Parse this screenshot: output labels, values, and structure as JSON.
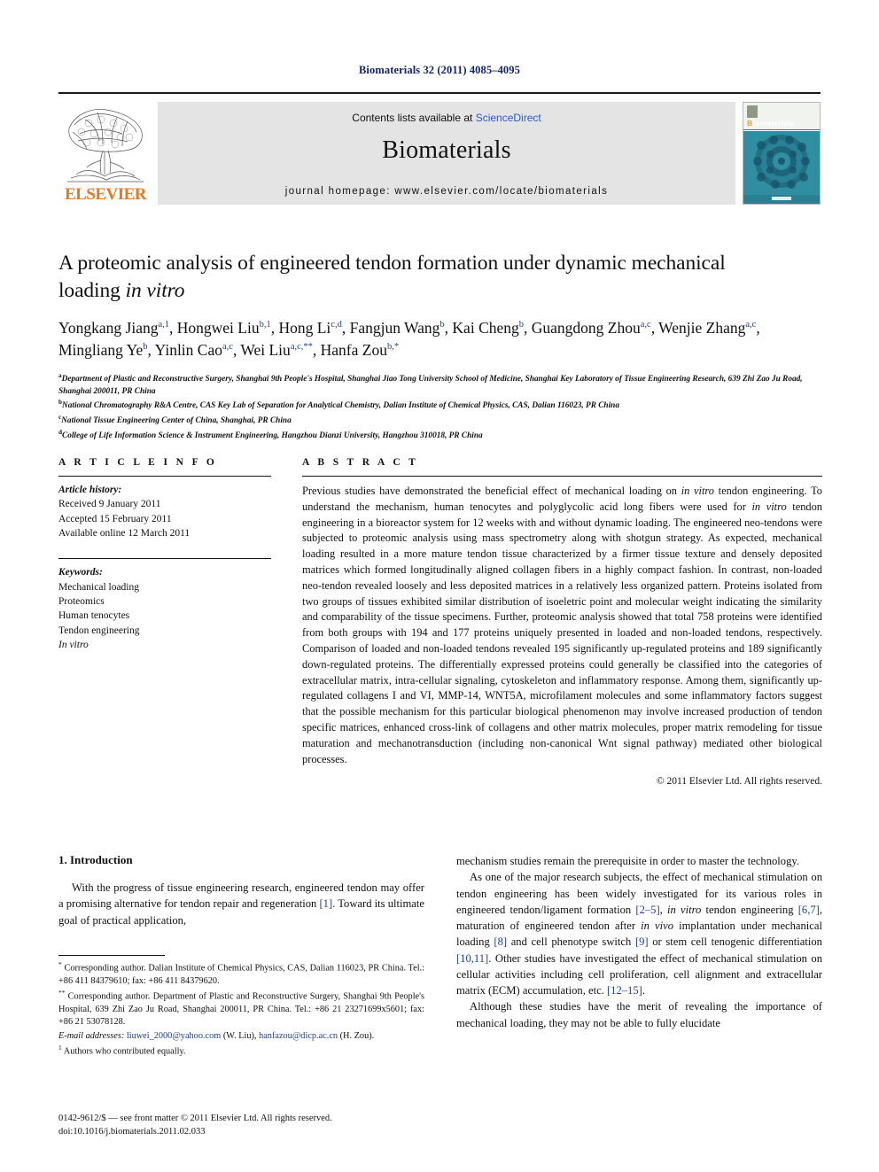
{
  "running_head": "Biomaterials 32 (2011) 4085–4095",
  "masthead": {
    "publisher_name": "ELSEVIER",
    "contents_prefix": "Contents lists available at ",
    "contents_link": "ScienceDirect",
    "journal_title": "Biomaterials",
    "homepage": "journal homepage: www.elsevier.com/locate/biomaterials",
    "cover_title_first": "B",
    "cover_title_rest": "iomaterials",
    "cover_footer": "ELSEVIER"
  },
  "article": {
    "title_line1": "A proteomic analysis of engineered tendon formation under dynamic mechanical",
    "title_line2_plain": "loading ",
    "title_line2_italic": "in vitro",
    "authors": [
      {
        "name": "Yongkang Jiang",
        "sup": "a,1"
      },
      {
        "name": "Hongwei Liu",
        "sup": "b,1"
      },
      {
        "name": "Hong Li",
        "sup": "c,d"
      },
      {
        "name": "Fangjun Wang",
        "sup": "b"
      },
      {
        "name": "Kai Cheng",
        "sup": "b"
      },
      {
        "name": "Guangdong Zhou",
        "sup": "a,c"
      },
      {
        "name": "Wenjie Zhang",
        "sup": "a,c"
      },
      {
        "name": "Mingliang Ye",
        "sup": "b"
      },
      {
        "name": "Yinlin Cao",
        "sup": "a,c"
      },
      {
        "name": "Wei Liu",
        "sup": "a,c,**"
      },
      {
        "name": "Hanfa Zou",
        "sup": "b,*"
      }
    ],
    "affiliations": [
      {
        "mark": "a",
        "text": "Department of Plastic and Reconstructive Surgery, Shanghai 9th People's Hospital, Shanghai Jiao Tong University School of Medicine, Shanghai Key Laboratory of Tissue Engineering Research, 639 Zhi Zao Ju Road, Shanghai 200011, PR China"
      },
      {
        "mark": "b",
        "text": "National Chromatography R&A Centre, CAS Key Lab of Separation for Analytical Chemistry, Dalian Institute of Chemical Physics, CAS, Dalian 116023, PR China"
      },
      {
        "mark": "c",
        "text": "National Tissue Engineering Center of China, Shanghai, PR China"
      },
      {
        "mark": "d",
        "text": "College of Life Information Science & Instrument Engineering, Hangzhou Dianzi University, Hangzhou 310018, PR China"
      }
    ]
  },
  "article_info": {
    "heading": "A R T I C L E   I N F O",
    "history_label": "Article history:",
    "history": [
      "Received 9 January 2011",
      "Accepted 15 February 2011",
      "Available online 12 March 2011"
    ],
    "keywords_label": "Keywords:",
    "keywords": [
      "Mechanical loading",
      "Proteomics",
      "Human tenocytes",
      "Tendon engineering",
      "In vitro"
    ]
  },
  "abstract": {
    "heading": "A B S T R A C T",
    "paragraph_html": "Previous studies have demonstrated the beneficial effect of mechanical loading on <i>in vitro</i> tendon engineering. To understand the mechanism, human tenocytes and polyglycolic acid long fibers were used for <i>in vitro</i> tendon engineering in a bioreactor system for 12 weeks with and without dynamic loading. The engineered neo-tendons were subjected to proteomic analysis using mass spectrometry along with shotgun strategy. As expected, mechanical loading resulted in a more mature tendon tissue characterized by a firmer tissue texture and densely deposited matrices which formed longitudinally aligned collagen fibers in a highly compact fashion. In contrast, non-loaded neo-tendon revealed loosely and less deposited matrices in a relatively less organized pattern. Proteins isolated from two groups of tissues exhibited similar distribution of isoeletric point and molecular weight indicating the similarity and comparability of the tissue specimens. Further, proteomic analysis showed that total 758 proteins were identified from both groups with 194 and 177 proteins uniquely presented in loaded and non-loaded tendons, respectively. Comparison of loaded and non-loaded tendons revealed 195 significantly up-regulated proteins and 189 significantly down-regulated proteins. The differentially expressed proteins could generally be classified into the categories of extracellular matrix, intra-cellular signaling, cytoskeleton and inflammatory response. Among them, significantly up-regulated collagens I and VI, MMP-14, WNT5A, microfilament molecules and some inflammatory factors suggest that the possible mechanism for this particular biological phenomenon may involve increased production of tendon specific matrices, enhanced cross-link of collagens and other matrix molecules, proper matrix remodeling for tissue maturation and mechanotransduction (including non-canonical Wnt signal pathway) mediated other biological processes.",
    "copyright": "© 2011 Elsevier Ltd. All rights reserved."
  },
  "introduction": {
    "heading": "1.  Introduction",
    "left_paragraph_html": "With the progress of tissue engineering research, engineered tendon may offer a promising alternative for tendon repair and regeneration <span class=\"ref\">[1]</span>. Toward its ultimate goal of practical application,",
    "right_paragraph_1": "mechanism studies remain the prerequisite in order to master the technology.",
    "right_paragraph_2_html": "As one of the major research subjects, the effect of mechanical stimulation on tendon engineering has been widely investigated for its various roles in engineered tendon/ligament formation <span class=\"ref\">[2–5]</span>, <i>in vitro</i> tendon engineering <span class=\"ref\">[6,7]</span>, maturation of engineered tendon after <i>in vivo</i> implantation under mechanical loading <span class=\"ref\">[8]</span> and cell phenotype switch <span class=\"ref\">[9]</span> or stem cell tenogenic differentiation <span class=\"ref\">[10,11]</span>. Other studies have investigated the effect of mechanical stimulation on cellular activities including cell proliferation, cell alignment and extracellular matrix (ECM) accumulation, etc. <span class=\"ref\">[12–15]</span>.",
    "right_paragraph_3": "Although these studies have the merit of revealing the importance of mechanical loading, they may not be able to fully elucidate"
  },
  "footnotes": {
    "corresponding_1_html": "<sup>*</sup> Corresponding author. Dalian Institute of Chemical Physics, CAS, Dalian 116023, PR China. Tel.: +86 411 84379610; fax: +86 411 84379620.",
    "corresponding_2_html": "<sup>**</sup> Corresponding author. Department of Plastic and Reconstructive Surgery, Shanghai 9th People's Hospital, 639 Zhi Zao Ju Road, Shanghai 200011, PR China. Tel.: +86 21 23271699x5601; fax: +86 21 53078128.",
    "email_html": "<span class=\"email-lab\">E-mail addresses:</span> <span class=\"mail\">liuwei_2000@yahoo.com</span> (W. Liu), <span class=\"mail\">hanfazou@dicp.ac.cn</span> (H. Zou).",
    "equal_contrib_html": "<sup>1</sup> Authors who contributed equally."
  },
  "footer": {
    "issn_line": "0142-9612/$ — see front matter © 2011 Elsevier Ltd. All rights reserved.",
    "doi_line": "doi:10.1016/j.biomaterials.2011.02.033"
  },
  "colors": {
    "link_blue": "#20408f",
    "sciencedirect_blue": "#2a58c4",
    "elsevier_orange": "#e87722",
    "running_head_navy": "#15256b",
    "band_gray": "#e4e4e4",
    "cover_teal": "#2a7f92"
  }
}
